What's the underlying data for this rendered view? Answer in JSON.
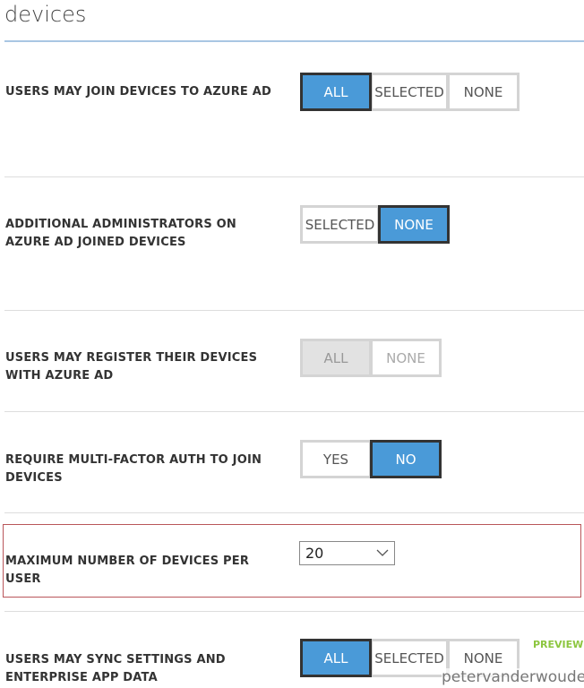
{
  "title": "devices",
  "settings": [
    {
      "label": "USERS MAY JOIN DEVICES TO AZURE AD",
      "options": [
        "ALL",
        "SELECTED",
        "NONE"
      ],
      "selected": "ALL"
    },
    {
      "label": "ADDITIONAL ADMINISTRATORS ON AZURE AD JOINED DEVICES",
      "options": [
        "SELECTED",
        "NONE"
      ],
      "selected": "NONE"
    },
    {
      "label": "USERS MAY REGISTER THEIR DEVICES WITH AZURE AD",
      "options": [
        "ALL",
        "NONE"
      ],
      "selected": "ALL",
      "disabled": true
    },
    {
      "label": "REQUIRE MULTI-FACTOR AUTH TO JOIN DEVICES",
      "options": [
        "YES",
        "NO"
      ],
      "selected": "NO"
    },
    {
      "label": "MAXIMUM NUMBER OF DEVICES PER USER",
      "value": "20"
    },
    {
      "label": "USERS MAY SYNC SETTINGS AND ENTERPRISE APP DATA",
      "options": [
        "ALL",
        "SELECTED",
        "NONE"
      ],
      "selected": "ALL",
      "badge": "PREVIEW"
    }
  ],
  "watermark": "petervanderwoude.nl",
  "colors": {
    "accent": "#4a9ad8",
    "highlight": "#b9565a",
    "preview": "#8cc63f"
  }
}
